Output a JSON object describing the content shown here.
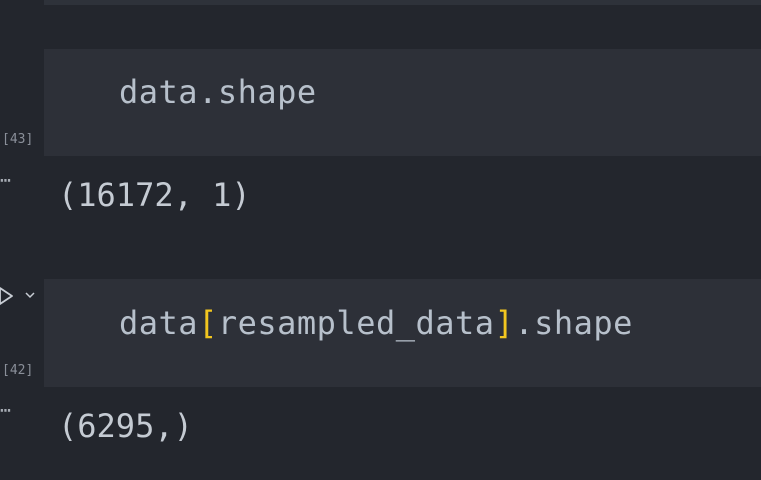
{
  "cells": [
    {
      "exec_count": "[43]",
      "code_plain": "data.shape",
      "output_ellipsis": "⋯",
      "output": "(16172, 1)"
    },
    {
      "exec_count": "[42]",
      "code_prefix": "data",
      "bracket_open": "[",
      "code_mid": "resampled_data",
      "bracket_close": "]",
      "code_suffix": ".shape",
      "output_ellipsis": "⋯",
      "output": "(6295,)"
    }
  ],
  "icons": {
    "run": "play-icon",
    "collapse": "chevron-down-icon"
  },
  "colors": {
    "background": "#23262d",
    "cell_input": "#2d3038",
    "code_text": "#b7c0cb",
    "bracket": "#f2c61f",
    "output_text": "#c5cbd3"
  }
}
